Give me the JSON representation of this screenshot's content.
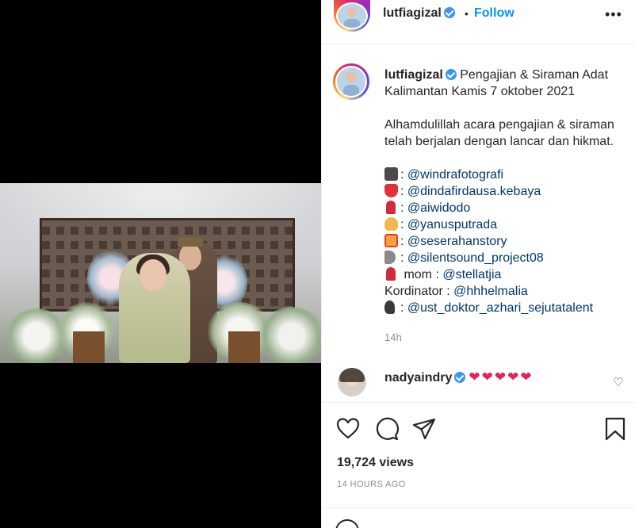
{
  "post": {
    "username": "lutfiagizal",
    "verified": true,
    "follow_label": "Follow",
    "separator": "•",
    "more_icon": "more-horizontal-icon",
    "image_alt_subject": "wedding couple photo"
  },
  "caption": {
    "username": "lutfiagizal",
    "title": "Pengajian & Siraman Adat Kalimantan Kamis 7 oktober 2021",
    "paragraph": "Alhamdulillah acara pengajian & siraman telah berjalan dengan lancar dan hikmat.",
    "credits": [
      {
        "emoji": "camera",
        "prefix": ": ",
        "handle": "@windrafotografi"
      },
      {
        "emoji": "dress",
        "prefix": ": ",
        "handle": "@dindafirdausa.kebaya"
      },
      {
        "emoji": "lipstick",
        "prefix": ": ",
        "handle": "@aiwidodo"
      },
      {
        "emoji": "person",
        "prefix": ": ",
        "handle": "@yanusputrada"
      },
      {
        "emoji": "gift",
        "prefix": ": ",
        "handle": "@seserahanstory"
      },
      {
        "emoji": "speaker",
        "prefix": ": ",
        "handle": "@silentsound_project08"
      },
      {
        "emoji": "lipstick",
        "prefix": " mom : ",
        "handle": "@stellatjia"
      },
      {
        "emoji": "",
        "prefix": "Kordinator : ",
        "handle": "@hhhelmalia"
      },
      {
        "emoji": "head",
        "prefix": ": ",
        "handle": "@ust_doktor_azhari_sejutatalent"
      }
    ],
    "time": "14h"
  },
  "comment": {
    "username": "nadyaindry",
    "verified": true,
    "hearts": "❤❤❤❤❤"
  },
  "stats": {
    "views": "19,724 views",
    "ago": "14 HOURS AGO"
  },
  "colors": {
    "link": "#00376b",
    "follow": "#0095f6",
    "verified": "#3897f0",
    "heart": "#e0245e",
    "muted": "#8e8e8e"
  }
}
